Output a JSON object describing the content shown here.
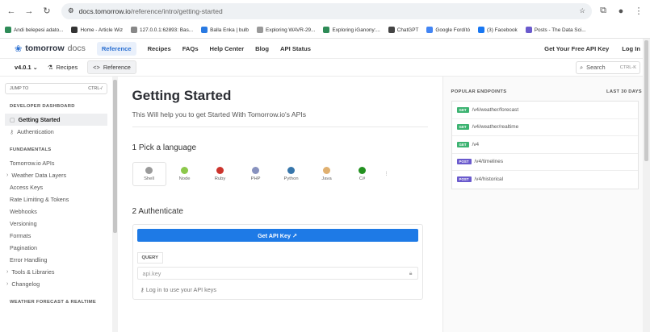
{
  "browser": {
    "url_host": "docs.tomorrow.io",
    "url_path": "/reference/intro/getting-started",
    "bookmarks": [
      {
        "label": "Andi belepesi adato...",
        "color": "#2e8b57"
      },
      {
        "label": "Home - Article Wiz",
        "color": "#333333"
      },
      {
        "label": "127.0.0.1:62893: Bas...",
        "color": "#888888"
      },
      {
        "label": "Balla Enka | bulb",
        "color": "#2a7ae2"
      },
      {
        "label": "Exploring WAVR-29...",
        "color": "#999999"
      },
      {
        "label": "Exploring iGanony:...",
        "color": "#2e8b57"
      },
      {
        "label": "ChatGPT",
        "color": "#444444"
      },
      {
        "label": "Google Fordító",
        "color": "#4285f4"
      },
      {
        "label": "(3) Facebook",
        "color": "#1877f2"
      },
      {
        "label": "Posts - The Data Sci...",
        "color": "#6a5acd"
      }
    ]
  },
  "header": {
    "logo_main": "tomorrow",
    "logo_docs": "docs",
    "nav": [
      "Reference",
      "Recipes",
      "FAQs",
      "Help Center",
      "Blog",
      "API Status"
    ],
    "right": [
      "Get Your Free API Key",
      "Log In"
    ]
  },
  "subbar": {
    "version": "v4.0.1",
    "tabs": [
      "Recipes",
      "Reference"
    ],
    "search_label": "Search",
    "search_kbd": "CTRL-K"
  },
  "sidebar": {
    "jump_label": "JUMP TO",
    "jump_kbd": "CTRL-/",
    "section1": "DEVELOPER DASHBOARD",
    "items1": [
      "Getting Started",
      "Authentication"
    ],
    "section2": "FUNDAMENTALS",
    "items2": [
      "Tomorrow.io APIs",
      "Weather Data Layers",
      "Access Keys",
      "Rate Limiting & Tokens",
      "Webhooks",
      "Versioning",
      "Formats",
      "Pagination",
      "Error Handling",
      "Tools & Libraries",
      "Changelog"
    ],
    "section3": "WEATHER FORECAST & REALTIME"
  },
  "content": {
    "title": "Getting Started",
    "subtitle": "This Will help you to get Started With Tomorrow.io's APIs",
    "step1": "1  Pick a language",
    "languages": [
      {
        "label": "Shell",
        "color": "#9a9a9a"
      },
      {
        "label": "Node",
        "color": "#8cc84b"
      },
      {
        "label": "Ruby",
        "color": "#cc342d"
      },
      {
        "label": "PHP",
        "color": "#8892bf"
      },
      {
        "label": "Python",
        "color": "#3776ab"
      },
      {
        "label": "Java",
        "color": "#e0b070"
      },
      {
        "label": "C#",
        "color": "#239120"
      }
    ],
    "more": "⋮",
    "step2": "2  Authenticate",
    "api_button": "Get API Key ↗",
    "query_label": "QUERY",
    "api_input_placeholder": "api.key",
    "login_hint": "Log in to use your API keys"
  },
  "right_panel": {
    "title": "POPULAR ENDPOINTS",
    "period": "LAST 30 DAYS",
    "endpoints": [
      {
        "method": "GET",
        "path": "/v4/weather/forecast",
        "color": "#3cb371"
      },
      {
        "method": "GET",
        "path": "/v4/weather/realtime",
        "color": "#3cb371"
      },
      {
        "method": "GET",
        "path": "/v4",
        "color": "#3cb371"
      },
      {
        "method": "POST",
        "path": "/v4/timelines",
        "color": "#6a5acd"
      },
      {
        "method": "POST",
        "path": "/v4/historical",
        "color": "#6a5acd"
      }
    ]
  }
}
